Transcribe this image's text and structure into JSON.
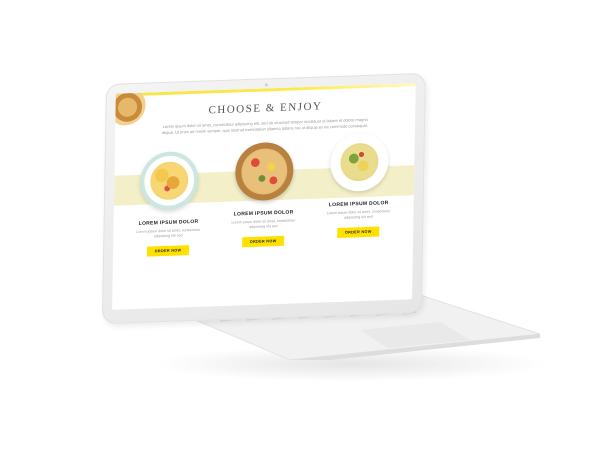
{
  "site": {
    "title": "CHOOSE & ENJOY",
    "description": "Lorem ipsum dolor sit amet, consectetur adipiscing elit, sed do eiusmod tempor incididunt ut labore et dolore magna aliqua. Ut enim ad minim veniam, quis nostrud exercitation ullamco laboris nisi ut aliquip ex ea commodo consequat."
  },
  "products": [
    {
      "name": "LOREM IPSUM DOLOR",
      "text": "Lorem ipsum dolor sit amet, consectetur adipiscing elit sed",
      "button": "ORDER NOW",
      "dish": "pasta"
    },
    {
      "name": "LOREM IPSUM DOLOR",
      "text": "Lorem ipsum dolor sit amet, consectetur adipiscing elit sed",
      "button": "ORDER NOW",
      "dish": "toast"
    },
    {
      "name": "LOREM IPSUM DOLOR",
      "text": "Lorem ipsum dolor sit amet, consectetur adipiscing elit sed",
      "button": "ORDER NOW",
      "dish": "salad"
    }
  ],
  "colors": {
    "accent": "#ffe100",
    "band": "#f3f0c9",
    "laptop": "#eeeeee"
  }
}
